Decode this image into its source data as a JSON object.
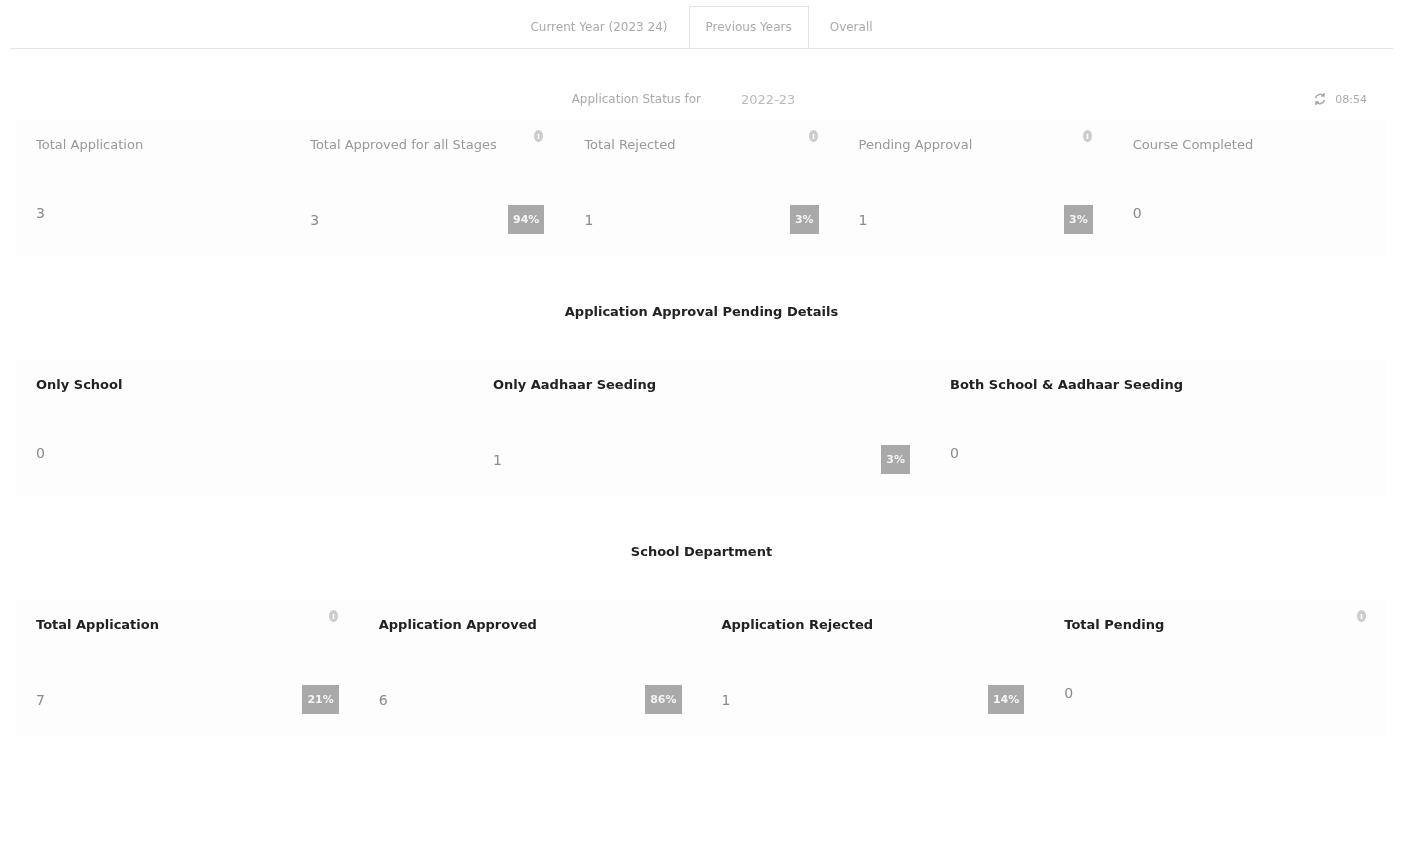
{
  "tabs": [
    {
      "label": "Current Year (2023 24)",
      "selected": false
    },
    {
      "label": "Previous Years",
      "selected": true
    },
    {
      "label": "Overall",
      "selected": false
    }
  ],
  "status": {
    "label": "Application Status for",
    "year": "2022-23",
    "time": "08:54"
  },
  "overview": [
    {
      "title": "Total Application",
      "value": "3",
      "info": false
    },
    {
      "title": "Total Approved for all Stages",
      "value": "3",
      "info": true,
      "badge": "94%"
    },
    {
      "title": "Total Rejected",
      "value": "1",
      "info": true,
      "badge": "3%"
    },
    {
      "title": "Pending Approval",
      "value": "1",
      "info": true,
      "badge": "3%"
    },
    {
      "title": "Course Completed",
      "value": "0",
      "info": false
    }
  ],
  "pending_details": {
    "title": "Application Approval Pending Details",
    "cards": [
      {
        "title": "Only School",
        "value": "0",
        "info": false
      },
      {
        "title": "Only Aadhaar Seeding",
        "value": "1",
        "info": false,
        "badge": "3%"
      },
      {
        "title": "Both School & Aadhaar Seeding",
        "value": "0",
        "info": false
      }
    ]
  },
  "school_department": {
    "title": "School Department",
    "cards": [
      {
        "title": "Total Application",
        "value": "7",
        "info": true,
        "badge": "21%"
      },
      {
        "title": "Application Approved",
        "value": "6",
        "info": false,
        "badge": "86%"
      },
      {
        "title": "Application Rejected",
        "value": "1",
        "info": false,
        "badge": "14%"
      },
      {
        "title": "Total Pending",
        "value": "0",
        "info": true
      }
    ]
  }
}
